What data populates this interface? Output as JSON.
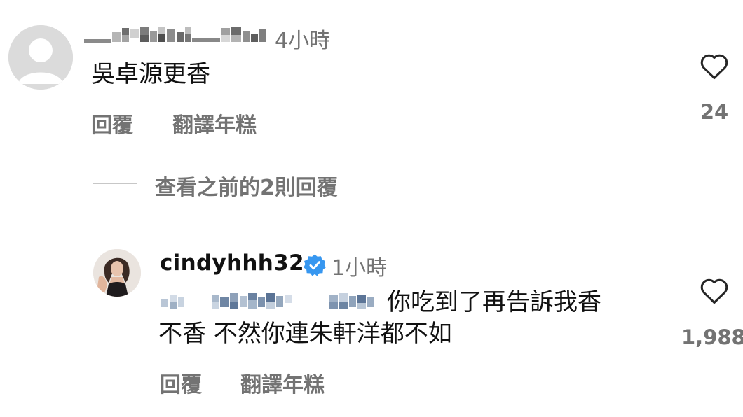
{
  "comment1": {
    "timestamp": "4小時",
    "text": "吳卓源更香",
    "reply_label": "回覆",
    "translate_label": "翻譯年糕",
    "like_count": "24"
  },
  "view_replies": {
    "label": "查看之前的2則回覆"
  },
  "comment2": {
    "username": "cindyhhh32",
    "timestamp": "1小時",
    "text_line1": "你吃到了再告訴我香",
    "text_line2": "不香 不然你連朱軒洋都不如",
    "reply_label": "回覆",
    "translate_label": "翻譯年糕",
    "like_count": "1,988"
  },
  "colors": {
    "verified_blue": "#3797f0",
    "secondary_text": "#737373",
    "avatar_placeholder": "#dbdbdb"
  },
  "icons": {
    "like": "heart-outline-icon",
    "verified": "verified-badge-icon",
    "avatar_default": "default-avatar-icon"
  }
}
